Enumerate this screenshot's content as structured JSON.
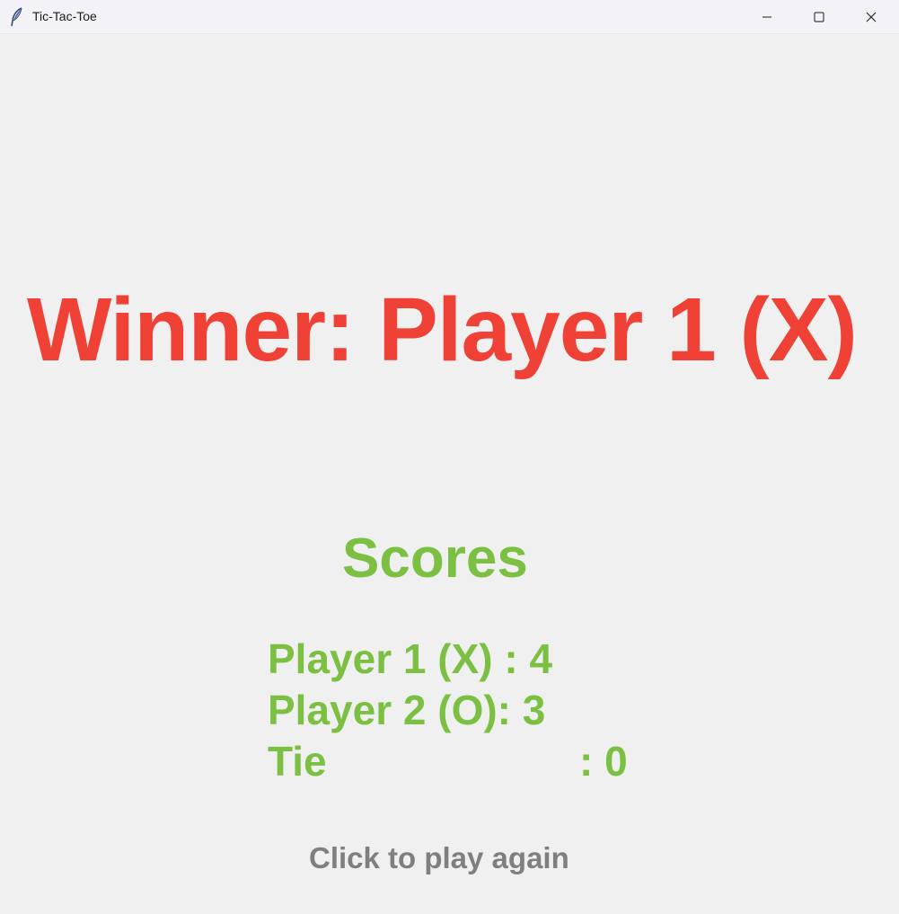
{
  "window": {
    "title": "Tic-Tac-Toe",
    "icon": "feather-icon",
    "controls": {
      "minimize_icon": "minimize-icon",
      "maximize_icon": "maximize-icon",
      "close_icon": "close-icon"
    }
  },
  "game": {
    "winner_text": "Winner: Player 1 (X)",
    "scores_title": "Scores",
    "scores": {
      "player1": "Player 1 (X) : 4",
      "player2": "Player 2 (O): 3",
      "tie_label": "Tie",
      "tie_value": ": 0"
    },
    "play_again": "Click to play again"
  },
  "colors": {
    "winner": "#ef4136",
    "scores": "#7bc043",
    "play_again": "#7f7f7f",
    "background": "#f0f0f0"
  }
}
